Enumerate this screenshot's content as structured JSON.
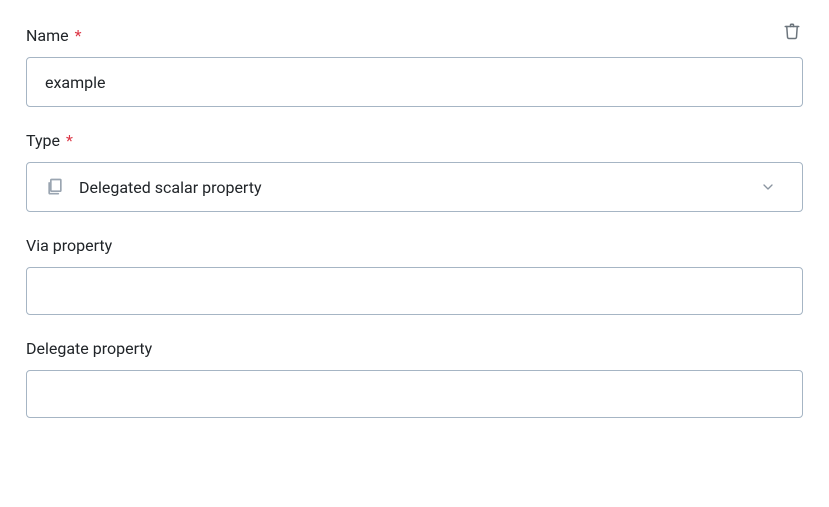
{
  "fields": {
    "name": {
      "label": "Name",
      "required_mark": "*",
      "value": "example"
    },
    "type": {
      "label": "Type",
      "required_mark": "*",
      "selected": "Delegated scalar property"
    },
    "via_property": {
      "label": "Via property",
      "value": ""
    },
    "delegate_property": {
      "label": "Delegate property",
      "value": ""
    }
  }
}
